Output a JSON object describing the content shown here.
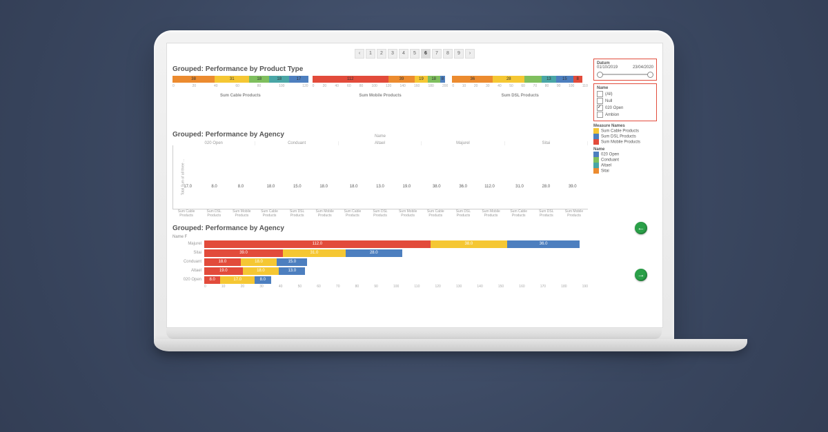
{
  "pagination": {
    "pages": [
      "‹",
      "1",
      "2",
      "3",
      "4",
      "5",
      "6",
      "7",
      "8",
      "9",
      "›"
    ],
    "active": 6
  },
  "section1": {
    "title": "Grouped: Performance by Product Type",
    "panels": [
      {
        "label": "Sum Cable Products",
        "max": 120,
        "ticks": [
          "0",
          "20",
          "40",
          "60",
          "80",
          "100",
          "120"
        ],
        "segs": [
          {
            "color": "c-orn",
            "v": 38,
            "label": "38"
          },
          {
            "color": "c-yel",
            "v": 31,
            "label": "31"
          },
          {
            "color": "c-grn",
            "v": 18,
            "label": "18"
          },
          {
            "color": "c-teal",
            "v": 18,
            "label": "18"
          },
          {
            "color": "c-blu",
            "v": 17,
            "label": "17"
          }
        ]
      },
      {
        "label": "Sum Mobile Products",
        "max": 200,
        "ticks": [
          "0",
          "20",
          "40",
          "60",
          "80",
          "100",
          "120",
          "140",
          "160",
          "180",
          "200"
        ],
        "segs": [
          {
            "color": "c-red",
            "v": 112,
            "label": "112"
          },
          {
            "color": "c-orn",
            "v": 39,
            "label": "39"
          },
          {
            "color": "c-yel",
            "v": 19,
            "label": "19"
          },
          {
            "color": "c-grn",
            "v": 18,
            "label": "18"
          },
          {
            "color": "c-blu",
            "v": 8,
            "label": "8"
          }
        ]
      },
      {
        "label": "Sum DSL Products",
        "max": 120,
        "ticks": [
          "0",
          "10",
          "20",
          "30",
          "40",
          "50",
          "60",
          "70",
          "80",
          "90",
          "100",
          "110"
        ],
        "segs": [
          {
            "color": "c-orn",
            "v": 36,
            "label": "36"
          },
          {
            "color": "c-yel",
            "v": 28,
            "label": "28"
          },
          {
            "color": "c-grn",
            "v": 15,
            "label": ""
          },
          {
            "color": "c-teal",
            "v": 13,
            "label": "13"
          },
          {
            "color": "c-blu",
            "v": 15,
            "label": "15"
          },
          {
            "color": "c-red",
            "v": 8,
            "label": "8"
          }
        ]
      }
    ]
  },
  "filters": {
    "datum": {
      "title": "Datum",
      "start": "01/10/2019",
      "end": "23/04/2020"
    },
    "name": {
      "title": "Name",
      "options": [
        {
          "label": "(All)",
          "on": false
        },
        {
          "label": "Null",
          "on": false
        },
        {
          "label": "020 Open",
          "on": true
        },
        {
          "label": "Ambion",
          "on": false
        }
      ]
    }
  },
  "legend": {
    "title": "Measure Names",
    "items": [
      {
        "color": "c-yel",
        "label": "Sum Cable Products"
      },
      {
        "color": "c-blu",
        "label": "Sum DSL Products"
      },
      {
        "color": "c-red",
        "label": "Sum Mobile Products"
      }
    ],
    "nameTitle": "Name",
    "names": [
      {
        "color": "c-blu",
        "label": "020 Open"
      },
      {
        "color": "c-grn",
        "label": "Conduant"
      },
      {
        "color": "c-teal",
        "label": "Altael"
      },
      {
        "color": "c-orn",
        "label": "Sitai"
      }
    ]
  },
  "section2": {
    "title": "Grouped: Performance by Agency",
    "axisLabel": "Name",
    "yLabel": "Total Sum of all three ...",
    "groups": [
      "020 Open",
      "Conduant",
      "Altael",
      "Majurel",
      "Sitai"
    ],
    "barLabels": [
      "Sum Cable Products",
      "Sum DSL Products",
      "Sum Mobile Products"
    ],
    "max": 112,
    "data": [
      [
        {
          "v": 17,
          "c": "c-yel",
          "l": "17.0"
        },
        {
          "v": 8,
          "c": "c-blu",
          "l": "8.0"
        },
        {
          "v": 8,
          "c": "c-red",
          "l": "8.0"
        }
      ],
      [
        {
          "v": 18,
          "c": "c-yel",
          "l": "18.0"
        },
        {
          "v": 15,
          "c": "c-blu",
          "l": "15.0"
        },
        {
          "v": 18,
          "c": "c-red",
          "l": "18.0"
        }
      ],
      [
        {
          "v": 18,
          "c": "c-yel",
          "l": "18.0"
        },
        {
          "v": 13,
          "c": "c-blu",
          "l": "13.0"
        },
        {
          "v": 19,
          "c": "c-red",
          "l": "19.0"
        }
      ],
      [
        {
          "v": 38,
          "c": "c-yel",
          "l": "38.0"
        },
        {
          "v": 36,
          "c": "c-blu",
          "l": "36.0"
        },
        {
          "v": 112,
          "c": "c-red",
          "l": "112.0"
        }
      ],
      [
        {
          "v": 31,
          "c": "c-yel",
          "l": "31.0"
        },
        {
          "v": 28,
          "c": "c-blu",
          "l": "28.0"
        },
        {
          "v": 39,
          "c": "c-red",
          "l": "39.0"
        }
      ]
    ]
  },
  "section3": {
    "title": "Grouped: Performance by Agency",
    "header": "Name F",
    "max": 190,
    "ticks": [
      "0",
      "10",
      "20",
      "30",
      "40",
      "50",
      "60",
      "70",
      "80",
      "90",
      "100",
      "110",
      "120",
      "130",
      "140",
      "150",
      "160",
      "170",
      "180",
      "190"
    ],
    "rows": [
      {
        "name": "Majurel",
        "segs": [
          {
            "c": "c-red",
            "v": 112,
            "l": "112.0"
          },
          {
            "c": "c-yel",
            "v": 38,
            "l": "38.0"
          },
          {
            "c": "c-blu",
            "v": 36,
            "l": "36.0"
          }
        ]
      },
      {
        "name": "Sitai",
        "segs": [
          {
            "c": "c-red",
            "v": 39,
            "l": "39.0"
          },
          {
            "c": "c-yel",
            "v": 31,
            "l": "31.0"
          },
          {
            "c": "c-blu",
            "v": 28,
            "l": "28.0"
          }
        ]
      },
      {
        "name": "Conduant",
        "segs": [
          {
            "c": "c-red",
            "v": 18,
            "l": "18.0"
          },
          {
            "c": "c-yel",
            "v": 18,
            "l": "18.0"
          },
          {
            "c": "c-blu",
            "v": 15,
            "l": "15.0"
          }
        ]
      },
      {
        "name": "Altael",
        "segs": [
          {
            "c": "c-red",
            "v": 19,
            "l": "19.0"
          },
          {
            "c": "c-yel",
            "v": 18,
            "l": "18.0"
          },
          {
            "c": "c-blu",
            "v": 13,
            "l": "13.0"
          }
        ]
      },
      {
        "name": "020 Open",
        "segs": [
          {
            "c": "c-red",
            "v": 8,
            "l": "8.0"
          },
          {
            "c": "c-yel",
            "v": 17,
            "l": "17.0"
          },
          {
            "c": "c-blu",
            "v": 8,
            "l": "8.0"
          }
        ]
      }
    ]
  },
  "nav": {
    "prev": "←",
    "next": "→"
  },
  "chart_data": [
    {
      "type": "bar",
      "title": "Grouped: Performance by Product Type",
      "orientation": "horizontal-stacked",
      "panels": [
        {
          "name": "Sum Cable Products",
          "xlim": [
            0,
            120
          ],
          "segments": {
            "Majurel": 38,
            "Sitai": 31,
            "Conduant": 18,
            "Altael": 18,
            "020 Open": 17
          }
        },
        {
          "name": "Sum Mobile Products",
          "xlim": [
            0,
            200
          ],
          "segments": {
            "Majurel": 112,
            "Sitai": 39,
            "Altael": 19,
            "Conduant": 18,
            "020 Open": 8
          }
        },
        {
          "name": "Sum DSL Products",
          "xlim": [
            0,
            110
          ],
          "segments": {
            "Majurel": 36,
            "Sitai": 28,
            "Conduant": 15,
            "Altael": 13,
            "Other": 15,
            "020 Open": 8
          }
        }
      ]
    },
    {
      "type": "bar",
      "title": "Grouped: Performance by Agency",
      "ylabel": "Total Sum of all three ...",
      "xlabel": "Name",
      "ylim": [
        0,
        112
      ],
      "categories": [
        "020 Open",
        "Conduant",
        "Altael",
        "Majurel",
        "Sitai"
      ],
      "series": [
        {
          "name": "Sum Cable Products",
          "values": [
            17.0,
            18.0,
            18.0,
            38.0,
            31.0
          ]
        },
        {
          "name": "Sum DSL Products",
          "values": [
            8.0,
            15.0,
            13.0,
            36.0,
            28.0
          ]
        },
        {
          "name": "Sum Mobile Products",
          "values": [
            8.0,
            18.0,
            19.0,
            112.0,
            39.0
          ]
        }
      ]
    },
    {
      "type": "bar",
      "title": "Grouped: Performance by Agency",
      "orientation": "horizontal-stacked",
      "xlim": [
        0,
        190
      ],
      "categories": [
        "Majurel",
        "Sitai",
        "Conduant",
        "Altael",
        "020 Open"
      ],
      "series": [
        {
          "name": "Sum Mobile Products",
          "values": [
            112.0,
            39.0,
            18.0,
            19.0,
            8.0
          ]
        },
        {
          "name": "Sum Cable Products",
          "values": [
            38.0,
            31.0,
            18.0,
            18.0,
            17.0
          ]
        },
        {
          "name": "Sum DSL Products",
          "values": [
            36.0,
            28.0,
            15.0,
            13.0,
            8.0
          ]
        }
      ]
    }
  ]
}
